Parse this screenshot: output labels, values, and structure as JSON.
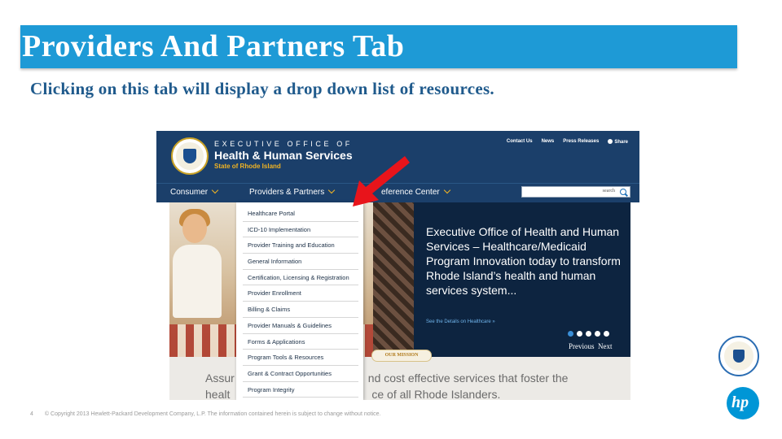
{
  "slide": {
    "title": "Providers And Partners Tab",
    "subtitle": "Clicking on this tab will display a drop down list of resources.",
    "page_number": "4",
    "footer": "© Copyright 2013 Hewlett-Packard Development Company, L.P.  The information contained herein is subject to change without notice.",
    "hp_logo_text": "hp"
  },
  "site": {
    "org_line1": "EXECUTIVE OFFICE OF",
    "org_line2": "Health & Human Services",
    "org_line3": "State of Rhode Island",
    "top_links": [
      "Contact Us",
      "News",
      "Press Releases",
      "Share"
    ],
    "nav": {
      "consumer": "Consumer",
      "providers": "Providers & Partners",
      "reference": "eference Center"
    },
    "search_placeholder": "search",
    "dropdown_items": [
      "Healthcare Portal",
      "ICD-10 Implementation",
      "Provider Training and Education",
      "General Information",
      "Certification, Licensing & Registration",
      "Provider Enrollment",
      "Billing & Claims",
      "Provider Manuals & Guidelines",
      "Forms & Applications",
      "Program Tools & Resources",
      "Grant & Contract Opportunities",
      "Program Integrity"
    ],
    "hero_text": "Executive Office of Health and Human Services – Healthcare/Medicaid Program Innovation today to transform Rhode Island’s health and human services system...",
    "hero_link": "See the Details on Healthcare »",
    "prev_label": "Previous",
    "next_label": "Next",
    "mission_badge": "OUR MISSION",
    "lower_text_left": "Assur",
    "lower_text_right": "nd cost effective services that foster the",
    "lower_text_left2": "healt",
    "lower_text_right2": "ce of all Rhode Islanders."
  },
  "colors": {
    "title_bar": "#1e9ad6",
    "subtitle": "#1f5a8c",
    "site_navy": "#1b3f6a",
    "accent_gold": "#f0b323",
    "arrow_red": "#e8141b",
    "hp_blue": "#0096d6"
  }
}
